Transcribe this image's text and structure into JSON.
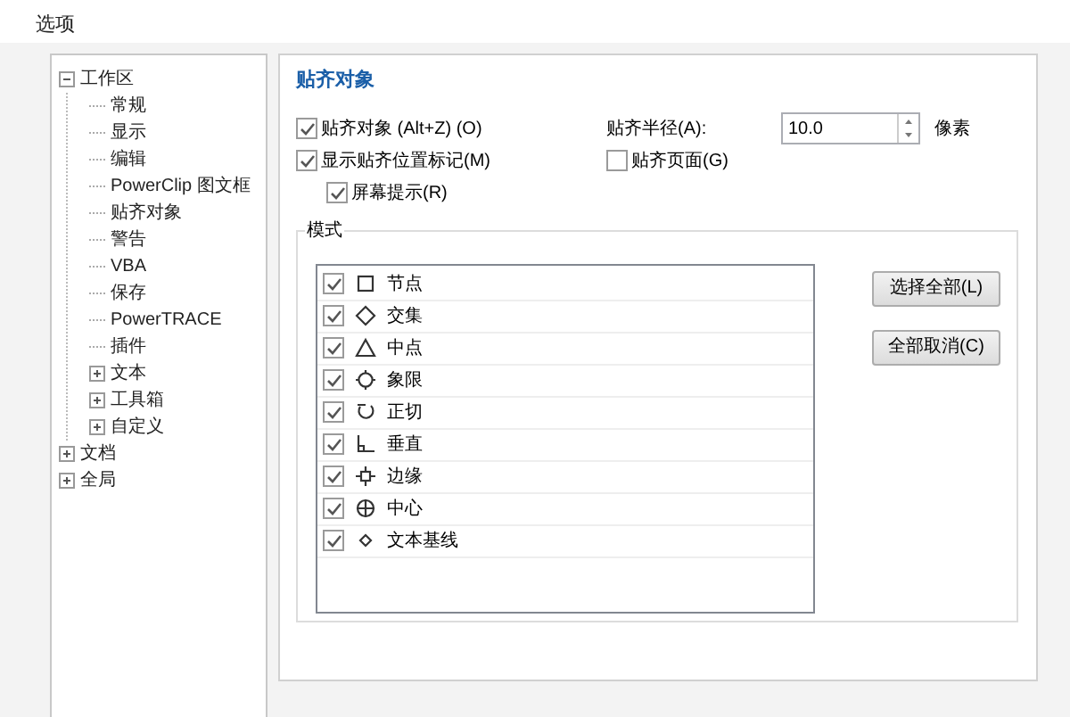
{
  "window": {
    "title": "选项"
  },
  "tree": [
    {
      "label": "工作区",
      "expanded": true,
      "children": [
        {
          "label": "常规"
        },
        {
          "label": "显示"
        },
        {
          "label": "编辑"
        },
        {
          "label": "PowerClip 图文框"
        },
        {
          "label": "贴齐对象"
        },
        {
          "label": "警告"
        },
        {
          "label": "VBA"
        },
        {
          "label": "保存"
        },
        {
          "label": "PowerTRACE"
        },
        {
          "label": "插件"
        },
        {
          "label": "文本",
          "expanded": false
        },
        {
          "label": "工具箱",
          "expanded": false
        },
        {
          "label": "自定义",
          "expanded": false
        }
      ]
    },
    {
      "label": "文档",
      "expanded": false
    },
    {
      "label": "全局",
      "expanded": false
    }
  ],
  "panel": {
    "heading": "贴齐对象",
    "snap_objects": {
      "label": "贴齐对象 (Alt+Z) (O)",
      "checked": true
    },
    "show_markers": {
      "label": "显示贴齐位置标记(M)",
      "checked": true
    },
    "screen_tips": {
      "label": "屏幕提示(R)",
      "checked": true
    },
    "radius": {
      "label": "贴齐半径(A):",
      "value": "10.0",
      "unit": "像素"
    },
    "snap_page": {
      "label": "贴齐页面(G)",
      "checked": false
    },
    "modes": {
      "title": "模式",
      "items": [
        {
          "kind": "node",
          "label": "节点",
          "checked": true
        },
        {
          "kind": "intersection",
          "label": "交集",
          "checked": true
        },
        {
          "kind": "midpoint",
          "label": "中点",
          "checked": true
        },
        {
          "kind": "quadrant",
          "label": "象限",
          "checked": true
        },
        {
          "kind": "tangent",
          "label": "正切",
          "checked": true
        },
        {
          "kind": "perpendicular",
          "label": "垂直",
          "checked": true
        },
        {
          "kind": "edge",
          "label": "边缘",
          "checked": true
        },
        {
          "kind": "center",
          "label": "中心",
          "checked": true
        },
        {
          "kind": "baseline",
          "label": "文本基线",
          "checked": true
        }
      ],
      "buttons": [
        "选择全部(L)",
        "全部取消(C)"
      ]
    }
  }
}
